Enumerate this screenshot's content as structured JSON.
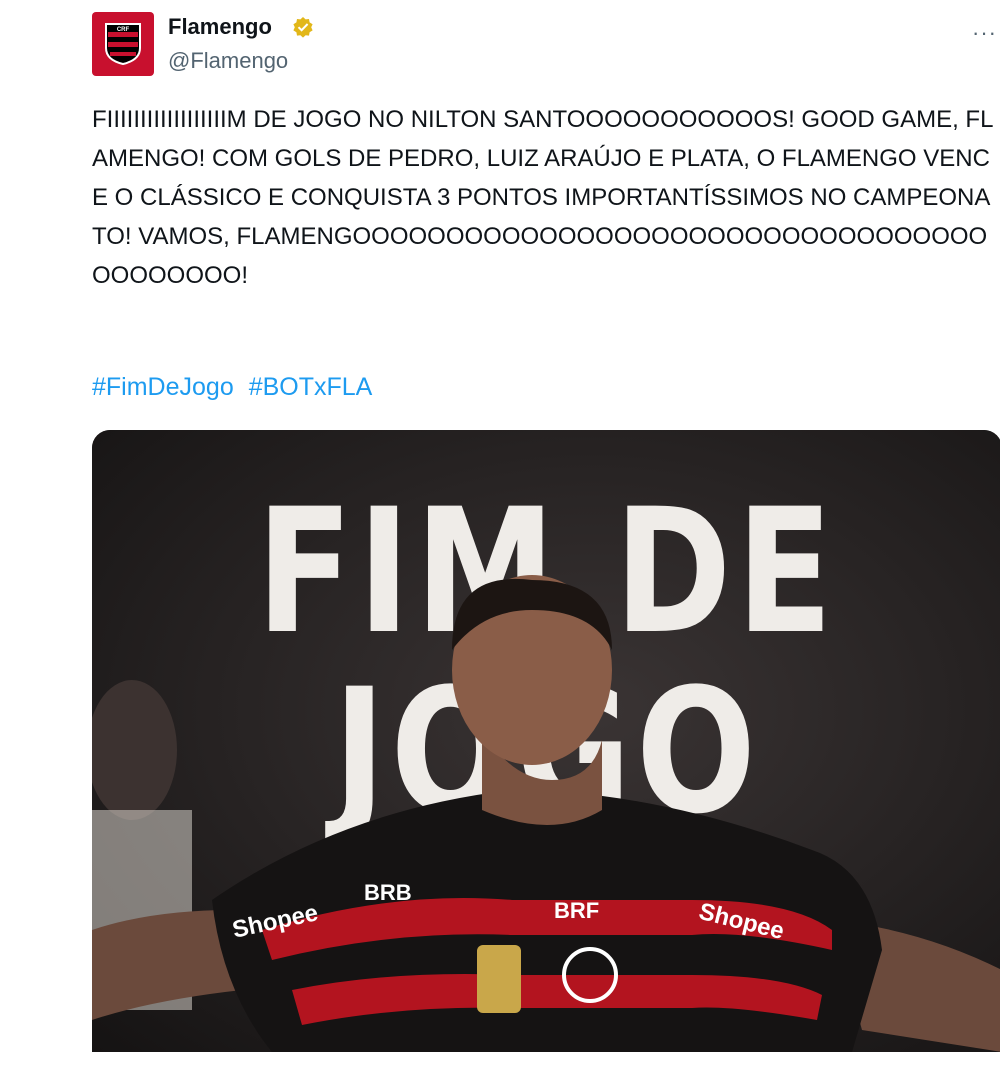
{
  "account": {
    "name": "Flamengo",
    "handle": "@Flamengo",
    "verified": true,
    "avatar_icon": "flamengo-crest-icon"
  },
  "tweet": {
    "text": "FIIIIIIIIIIIIIIIIIIM DE JOGO NO NILTON SANTOOOOOOOOOOOS! GOOD GAME, FLAMENGO! COM GOLS DE PEDRO, LUIZ ARAÚJO E PLATA, O FLAMENGO VENCE O CLÁSSICO E CONQUISTA 3 PONTOS IMPORTANTÍSSIMOS NO CAMPEONATO! VAMOS, FLAMENGOOOOOOOOOOOOOOOOOOOOOOOOOOOOOOOOOOOOOOOOOO!",
    "hashtags": [
      "#FimDeJogo",
      "#BOTxFLA"
    ]
  },
  "media": {
    "headline": "FIM DE JOGO",
    "shirt_sponsor_left": "Shopee",
    "shirt_sponsor_right": "Shopee",
    "shirt_brand_left": "BRB",
    "shirt_brand_right": "BRF"
  },
  "colors": {
    "brand_red": "#c8102e",
    "link_blue": "#1d9bf0",
    "verified_gold": "#e2b719"
  }
}
